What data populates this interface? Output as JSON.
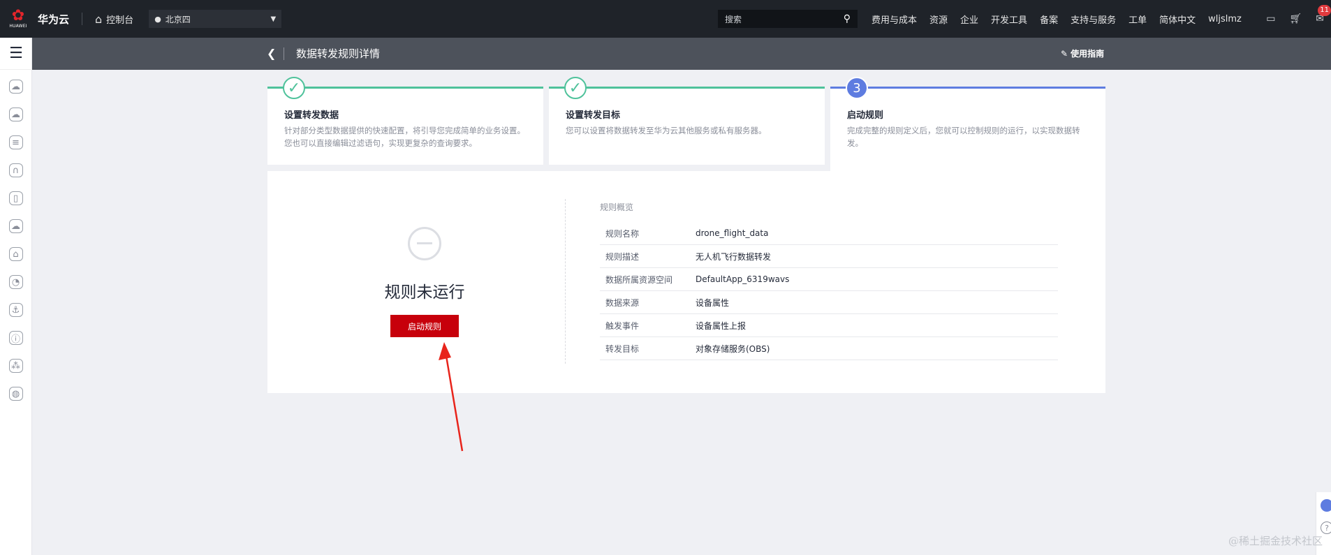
{
  "topbar": {
    "logo_brand": "HUAWEI",
    "logo_text": "华为云",
    "console": "控制台",
    "region": "北京四",
    "search_placeholder": "搜索",
    "nav": [
      "费用与成本",
      "资源",
      "企业",
      "开发工具",
      "备案",
      "支持与服务",
      "工单",
      "简体中文",
      "wljslmz"
    ],
    "badge_count": "11"
  },
  "header": {
    "title": "数据转发规则详情",
    "guide": "使用指南"
  },
  "steps": [
    {
      "number": "",
      "title": "设置转发数据",
      "desc": "针对部分类型数据提供的快速配置，将引导您完成简单的业务设置。您也可以直接编辑过滤语句，实现更复杂的查询要求。",
      "state": "done"
    },
    {
      "number": "",
      "title": "设置转发目标",
      "desc": "您可以设置将数据转发至华为云其他服务或私有服务器。",
      "state": "done"
    },
    {
      "number": "3",
      "title": "启动规则",
      "desc": "完成完整的规则定义后，您就可以控制规则的运行，以实现数据转发。",
      "state": "active"
    }
  ],
  "status": {
    "text": "规则未运行",
    "button": "启动规则"
  },
  "overview": {
    "title": "规则概览",
    "rows": [
      {
        "key": "规则名称",
        "value": "drone_flight_data"
      },
      {
        "key": "规则描述",
        "value": "无人机飞行数据转发"
      },
      {
        "key": "数据所属资源空间",
        "value": "DefaultApp_6319wavs"
      },
      {
        "key": "数据来源",
        "value": "设备属性"
      },
      {
        "key": "触发事件",
        "value": "设备属性上报"
      },
      {
        "key": "转发目标",
        "value": "对象存储服务(OBS)"
      }
    ]
  },
  "watermark": "@稀土掘金技术社区",
  "colors": {
    "accent_red": "#c7000b",
    "step_done": "#4fc29b",
    "step_active": "#5e7ce0"
  }
}
